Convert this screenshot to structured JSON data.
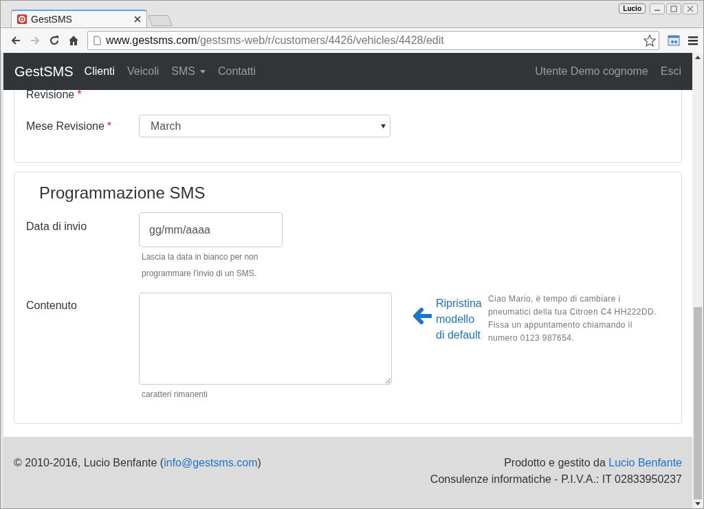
{
  "browser": {
    "tab_title": "GestSMS",
    "user_badge": "Lucio",
    "url_host": "www.gestsms.com",
    "url_path": "/gestsms-web/r/customers/4426/vehicles/4428/edit"
  },
  "navbar": {
    "brand": "GestSMS",
    "items": [
      {
        "label": "Clienti",
        "selected": true,
        "kind": "link"
      },
      {
        "label": "Veicoli",
        "selected": false,
        "kind": "link"
      },
      {
        "label": "SMS",
        "selected": false,
        "kind": "dropdown"
      },
      {
        "label": "Contatti",
        "selected": false,
        "kind": "link"
      }
    ],
    "right_items": [
      "Utente Demo cognome",
      "Esci"
    ]
  },
  "vehicle_panel": {
    "label_top": "Revisione",
    "label_top_required_mark": "*",
    "month": {
      "label": "Mese Revisione",
      "required_mark": "*",
      "value": "March"
    }
  },
  "sms_panel": {
    "title": "Programmazione SMS",
    "date": {
      "label": "Data di invio",
      "placeholder": "gg/mm/aaaa",
      "help": "Lascia la data in bianco per non programmare l'invio di un SMS."
    },
    "content": {
      "label": "Contenuto",
      "help": "caratteri rimanenti",
      "restore_link": "Ripristina modello di default",
      "template": "Ciao Mario, è tempo di cambiare i pneumatici della tua Citroen C4 HH222DD. Fissa un appuntamento chiamando il numero 0123 987654."
    }
  },
  "footer": {
    "copyright": "© 2010-2016, Lucio Benfante (",
    "email": "info@gestsms.com",
    "copyright_end": ")",
    "credit": "Prodotto e gestito da",
    "credit_link": "Lucio Benfante",
    "vat": "Consulenze informatiche - P.I.V.A.: IT 02833950237"
  }
}
